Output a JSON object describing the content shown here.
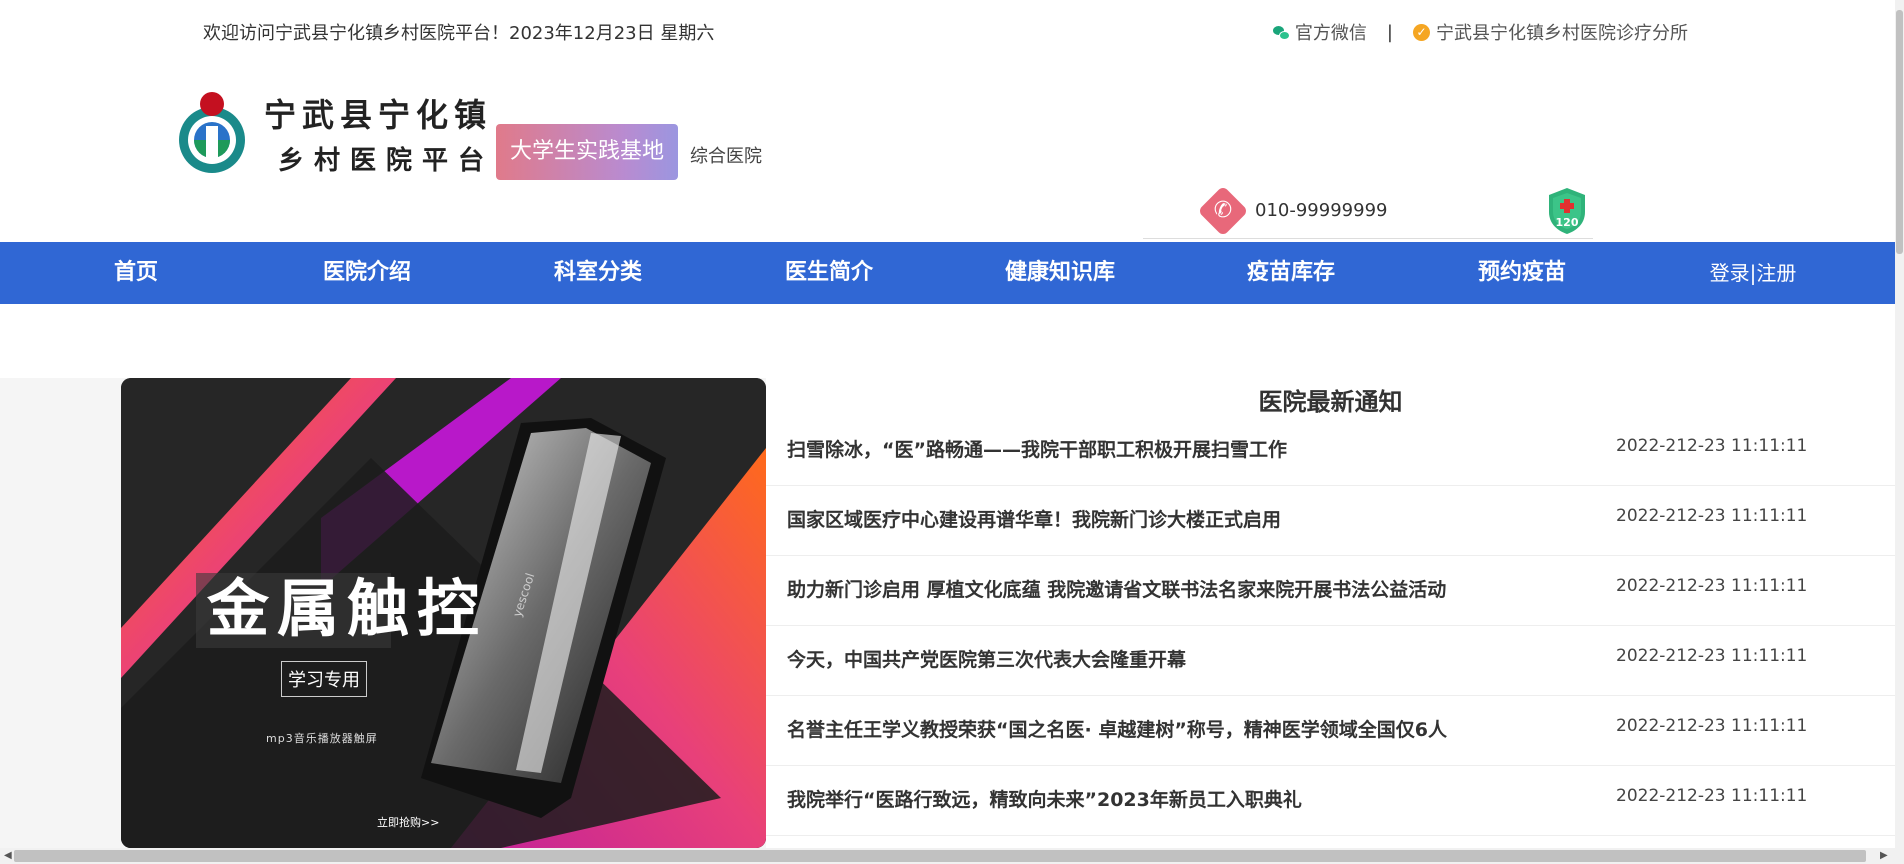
{
  "topbar": {
    "welcome": "欢迎访问宁武县宁化镇乡村医院平台！2023年12月23日 星期六",
    "wechat_label": "官方微信",
    "separator": "|",
    "branch_label": "宁武县宁化镇乡村医院诊疗分所"
  },
  "header": {
    "logo_line1": "宁武县宁化镇",
    "logo_line2": "乡村医院平台",
    "badge": "大学生实践基地",
    "badge_sub": "综合医院",
    "phone": "010-99999999",
    "emergency_label": "120"
  },
  "nav": {
    "items": [
      {
        "label": "首页"
      },
      {
        "label": "医院介绍"
      },
      {
        "label": "科室分类"
      },
      {
        "label": "医生简介"
      },
      {
        "label": "健康知识库"
      },
      {
        "label": "疫苗库存"
      },
      {
        "label": "预约疫苗"
      }
    ],
    "login": "登录|注册"
  },
  "banner": {
    "headline": "金属触控",
    "tag": "学习专用",
    "sub": "mp3音乐播放器触屏",
    "cta": "立即抢购>>",
    "brand": "yescool"
  },
  "notices": {
    "title": "医院最新通知",
    "items": [
      {
        "text": "扫雪除冰，“医”路畅通——我院干部职工积极开展扫雪工作",
        "date": "2022-212-23 11:11:11"
      },
      {
        "text": "国家区域医疗中心建设再谱华章！我院新门诊大楼正式启用",
        "date": "2022-212-23 11:11:11"
      },
      {
        "text": "助力新门诊启用 厚植文化底蕴 我院邀请省文联书法名家来院开展书法公益活动",
        "date": "2022-212-23 11:11:11"
      },
      {
        "text": "今天，中国共产党医院第三次代表大会隆重开幕",
        "date": "2022-212-23 11:11:11"
      },
      {
        "text": "名誉主任王学义教授荣获“国之名医· 卓越建树”称号，精神医学领域全国仅6人",
        "date": "2022-212-23 11:11:11"
      },
      {
        "text": "我院举行“医路行致远，精致向未来”2023年新员工入职典礼",
        "date": "2022-212-23 11:11:11"
      }
    ]
  },
  "colors": {
    "nav_bg": "#3067d4",
    "badge_start": "#e07a8a",
    "badge_end": "#9b96e0",
    "phone_icon": "#e8687a",
    "shield": "#2fb37a"
  }
}
